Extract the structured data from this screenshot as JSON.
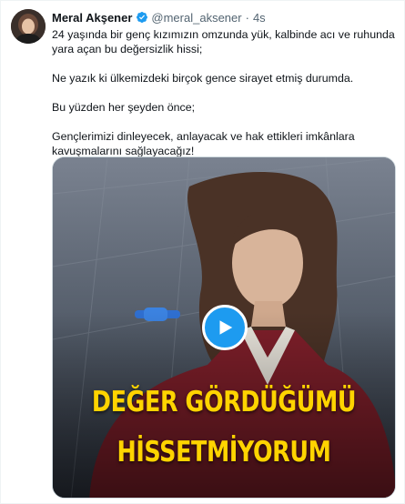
{
  "tweet": {
    "author_name": "Meral Akşener",
    "handle": "@meral_aksener",
    "separator": "·",
    "time": "4s",
    "paragraphs": [
      "24 yaşında bir genç kızımızın omzunda yük, kalbinde acı  ve ruhunda yara açan bu değersizlik hissi;",
      "Ne yazık ki ülkemizdeki birçok gence sirayet etmiş durumda.",
      "Bu yüzden her şeyden önce;",
      "Gençlerimizi dinleyecek, anlayacak ve hak ettikleri imkânlara kavuşmalarını sağlayacağız!"
    ]
  },
  "video": {
    "caption_line1": "DEĞER GÖRDÜĞÜMÜ",
    "caption_line2": "HİSSETMİYORUM"
  },
  "icons": {
    "verified": "verified-badge-icon",
    "play": "play-icon"
  },
  "colors": {
    "verified": "#1d9bf0",
    "play_button": "#1d9bf0",
    "caption": "#ffd400",
    "secondary_text": "#536471"
  }
}
